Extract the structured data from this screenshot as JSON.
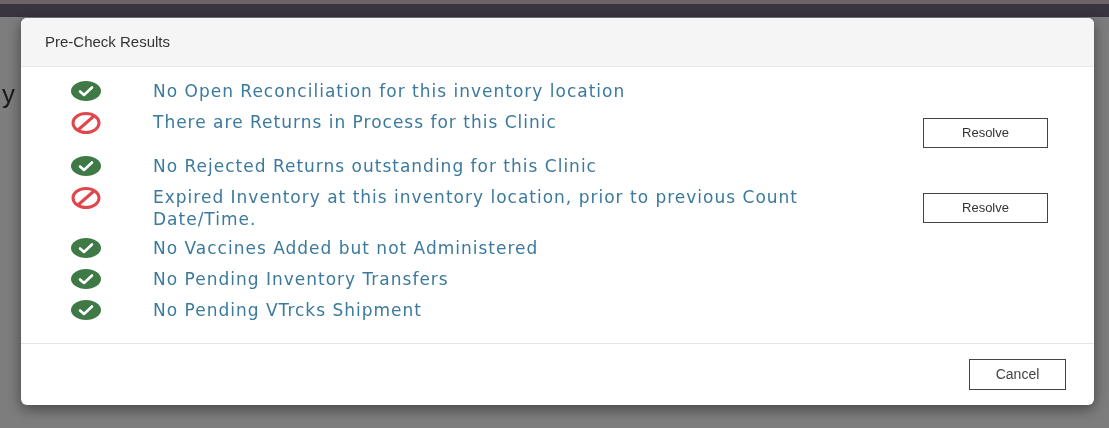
{
  "background": {
    "heading_fragment": "y"
  },
  "dialog": {
    "title": "Pre-Check Results",
    "checks": [
      {
        "passed": true,
        "text": "No Open Reconciliation for this inventory location"
      },
      {
        "passed": false,
        "text": "There are Returns in Process for this Clinic",
        "action": "Resolve"
      },
      {
        "passed": true,
        "text": "No Rejected Returns outstanding for this Clinic"
      },
      {
        "passed": false,
        "text": "Expired Inventory at this inventory location, prior to previous Count Date/Time.",
        "action": "Resolve"
      },
      {
        "passed": true,
        "text": "No Vaccines Added but not Administered"
      },
      {
        "passed": true,
        "text": "No Pending Inventory Transfers"
      },
      {
        "passed": true,
        "text": "No Pending VTrcks Shipment"
      }
    ],
    "footer_button": "Cancel"
  }
}
